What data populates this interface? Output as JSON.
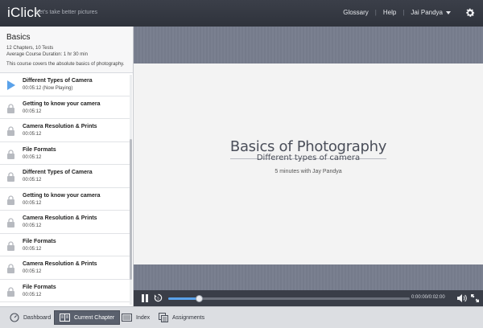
{
  "header": {
    "brand": "iClick",
    "tagline": "Let's take better pictures",
    "nav": [
      "Glossary",
      "Help"
    ],
    "user": "Jai Pandya"
  },
  "course": {
    "title": "Basics",
    "meta1": "12 Chapters, 10 Tests",
    "meta2": "Average Course Duration: 1 hr 30 min",
    "description": "This course covers the absolute basics of photography."
  },
  "chapters": [
    {
      "title": "Different Types of Camera",
      "detail": "00:05:12 (Now Playing)",
      "icon": "play-icon"
    },
    {
      "title": "Getting to know your camera",
      "detail": "00:05:12",
      "icon": "lock-icon"
    },
    {
      "title": "Camera Resolution & Prints",
      "detail": "00:05:12",
      "icon": "lock-icon"
    },
    {
      "title": "File Formats",
      "detail": "00:05:12",
      "icon": "lock-icon"
    },
    {
      "title": "Different Types of Camera",
      "detail": "00:05:12",
      "icon": "lock-icon"
    },
    {
      "title": "Getting to know your camera",
      "detail": "00:05:12",
      "icon": "lock-icon"
    },
    {
      "title": "Camera Resolution & Prints",
      "detail": "00:05:12",
      "icon": "lock-icon"
    },
    {
      "title": "File Formats",
      "detail": "00:05:12",
      "icon": "lock-icon"
    },
    {
      "title": "Camera Resolution & Prints",
      "detail": "00:05:12",
      "icon": "lock-icon"
    },
    {
      "title": "File Formats",
      "detail": "00:05:12",
      "icon": "lock-icon"
    }
  ],
  "slide": {
    "title": "Basics of Photography",
    "subtitle": "Different types of camera",
    "meta": "5 minutes with Jay Pandya"
  },
  "player": {
    "time": "0:00:00/0:02:00",
    "progress_fraction": 0.13
  },
  "tabs": {
    "dashboard": "Dashboard",
    "current_chapter": "Current Chapter",
    "index": "Index",
    "assignments": "Assignments"
  },
  "colors": {
    "accent": "#5aa2ea",
    "topbar": "#343842"
  }
}
